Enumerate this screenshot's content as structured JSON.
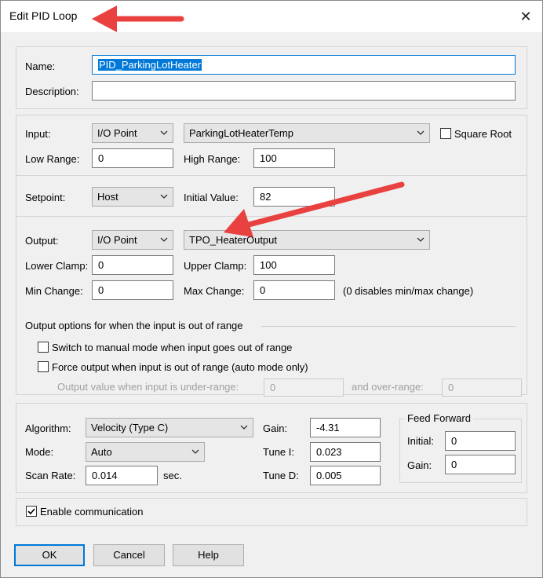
{
  "window": {
    "title": "Edit PID Loop"
  },
  "identity": {
    "name_label": "Name:",
    "name_value": "PID_ParkingLotHeater",
    "description_label": "Description:",
    "description_value": ""
  },
  "input": {
    "label": "Input:",
    "type": "I/O Point",
    "point": "ParkingLotHeaterTemp",
    "square_root_label": "Square Root",
    "low_range_label": "Low Range:",
    "low_range": "0",
    "high_range_label": "High Range:",
    "high_range": "100"
  },
  "setpoint": {
    "label": "Setpoint:",
    "type": "Host",
    "initial_label": "Initial Value:",
    "initial_value": "82"
  },
  "output": {
    "label": "Output:",
    "type": "I/O Point",
    "point": "TPO_HeaterOutput",
    "lower_clamp_label": "Lower Clamp:",
    "lower_clamp": "0",
    "upper_clamp_label": "Upper Clamp:",
    "upper_clamp": "100",
    "min_change_label": "Min Change:",
    "min_change": "0",
    "max_change_label": "Max Change:",
    "max_change": "0",
    "change_note": "(0 disables min/max change)"
  },
  "range_options": {
    "group_label": "Output options for when the input is out of range",
    "manual_label": "Switch to manual mode when input goes out of range",
    "force_label": "Force output when input is out of range (auto mode only)",
    "under_label": "Output value when input is under-range:",
    "under_value": "0",
    "over_label": "and over-range:",
    "over_value": "0"
  },
  "tuning": {
    "algorithm_label": "Algorithm:",
    "algorithm": "Velocity (Type C)",
    "mode_label": "Mode:",
    "mode": "Auto",
    "scan_rate_label": "Scan Rate:",
    "scan_rate": "0.014",
    "scan_unit": "sec.",
    "gain_label": "Gain:",
    "gain": "-4.31",
    "tune_i_label": "Tune I:",
    "tune_i": "0.023",
    "tune_d_label": "Tune D:",
    "tune_d": "0.005"
  },
  "feed_forward": {
    "group_label": "Feed Forward",
    "initial_label": "Initial:",
    "initial": "0",
    "gain_label": "Gain:",
    "gain": "0"
  },
  "comm": {
    "enable_label": "Enable communication",
    "enabled": true
  },
  "buttons": {
    "ok": "OK",
    "cancel": "Cancel",
    "help": "Help"
  },
  "annotation_color": "#e8413f"
}
